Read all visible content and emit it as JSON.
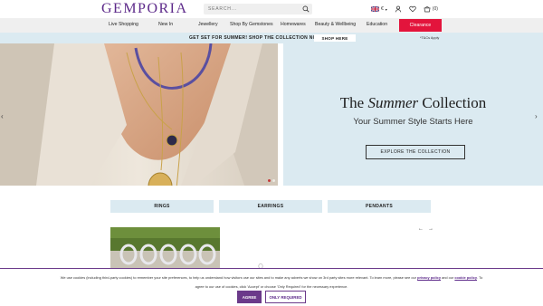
{
  "brand": {
    "logo": "GEMPORIA"
  },
  "search": {
    "placeholder": "SEARCH..."
  },
  "header": {
    "currency": "€",
    "cart_count": "(0)"
  },
  "nav": {
    "items": [
      "Live Shopping",
      "New In",
      "Jewellery",
      "Shop By Gemstones",
      "Homewares",
      "Beauty & Wellbeing",
      "Education"
    ],
    "clearance": "Clearance"
  },
  "promo": {
    "text": "GET SET FOR SUMMER! SHOP THE COLLECTION NOW!",
    "button": "SHOP HERE",
    "note": "*T&Cs Apply"
  },
  "hero": {
    "title_pre": "The ",
    "title_em": "Summer",
    "title_post": " Collection",
    "subtitle": "Your Summer Style Starts Here",
    "button": "EXPLORE THE COLLECTION"
  },
  "categories": [
    "RINGS",
    "EARRINGS",
    "PENDANTS"
  ],
  "cookie": {
    "line1_a": "We use cookies (including third-party cookies) to remember your site preferences, to help us understand how visitors use our sites and to make any adverts we show on 3rd party sites more relevant. To learn more, please see our ",
    "privacy_link": "privacy policy",
    "line1_b": " and our ",
    "cookie_link": "cookie policy",
    "line1_c": ". To",
    "line2": "agree to our use of cookies, click 'Accept' or choose 'Only Required' for the necessary experience.",
    "agree": "AGREE",
    "only_required": "ONLY REQUIRED"
  },
  "colors": {
    "brand": "#5d2a8a",
    "clearance": "#e3143c",
    "panel": "#dbeaf1"
  }
}
